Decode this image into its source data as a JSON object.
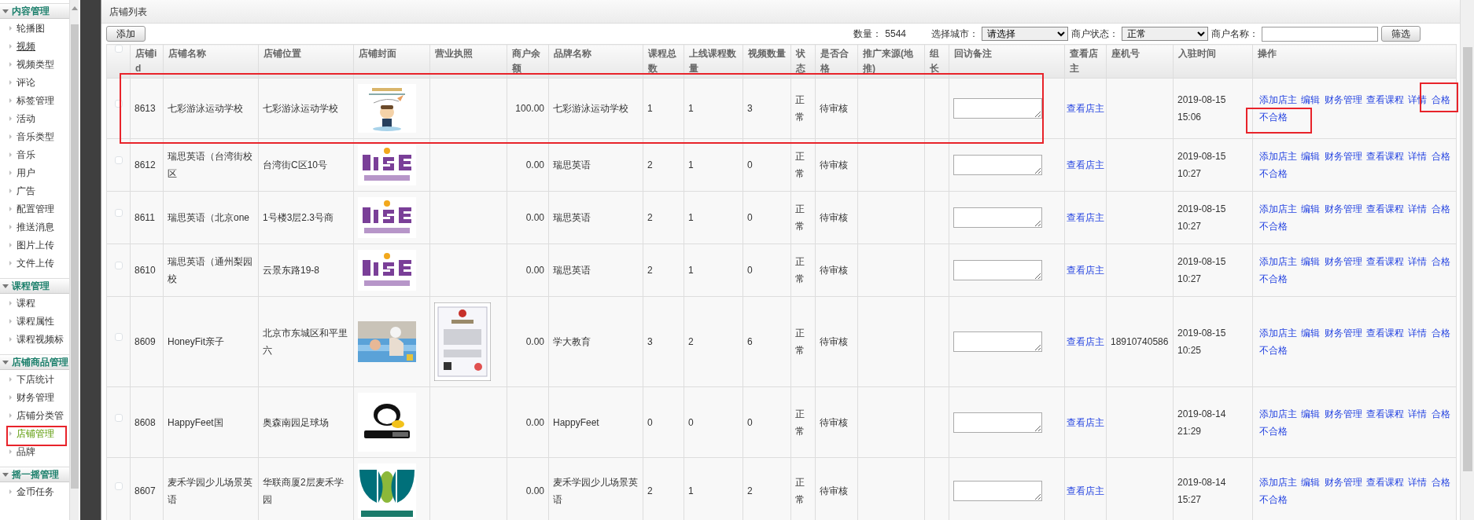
{
  "sidebar": {
    "groups": [
      {
        "title": "内容管理",
        "expanded": true,
        "items": [
          {
            "label": "轮播图",
            "selected": false,
            "hovered": false
          },
          {
            "label": "视频",
            "selected": false,
            "hovered": true
          },
          {
            "label": "视频类型",
            "selected": false,
            "hovered": false
          },
          {
            "label": "评论",
            "selected": false,
            "hovered": false
          },
          {
            "label": "标签管理",
            "selected": false,
            "hovered": false
          },
          {
            "label": "活动",
            "selected": false,
            "hovered": false
          },
          {
            "label": "音乐类型",
            "selected": false,
            "hovered": false
          },
          {
            "label": "音乐",
            "selected": false,
            "hovered": false
          },
          {
            "label": "用户",
            "selected": false,
            "hovered": false
          },
          {
            "label": "广告",
            "selected": false,
            "hovered": false
          },
          {
            "label": "配置管理",
            "selected": false,
            "hovered": false
          },
          {
            "label": "推送消息",
            "selected": false,
            "hovered": false
          },
          {
            "label": "图片上传",
            "selected": false,
            "hovered": false
          },
          {
            "label": "文件上传",
            "selected": false,
            "hovered": false
          }
        ]
      },
      {
        "title": "课程管理",
        "expanded": true,
        "items": [
          {
            "label": "课程",
            "selected": false,
            "hovered": false
          },
          {
            "label": "课程属性",
            "selected": false,
            "hovered": false
          },
          {
            "label": "课程视频标",
            "selected": false,
            "hovered": false
          }
        ]
      },
      {
        "title": "店铺商品管理",
        "expanded": true,
        "items": [
          {
            "label": "下店统计",
            "selected": false,
            "hovered": false
          },
          {
            "label": "财务管理",
            "selected": false,
            "hovered": false
          },
          {
            "label": "店铺分类管",
            "selected": false,
            "hovered": false
          },
          {
            "label": "店铺管理",
            "selected": true,
            "hovered": false
          },
          {
            "label": "品牌",
            "selected": false,
            "hovered": false
          }
        ]
      },
      {
        "title": "摇一摇管理",
        "expanded": true,
        "items": [
          {
            "label": "金币任务",
            "selected": false,
            "hovered": false
          }
        ]
      }
    ]
  },
  "panel": {
    "title": "店铺列表"
  },
  "toolbar": {
    "add_button": "添加",
    "count_label": "数量：",
    "count": "5544",
    "city_label": "选择城市：",
    "city_select": "请选择",
    "status_label": "商户状态：",
    "status_select": "正常",
    "name_label": "商户名称：",
    "search_button": "筛选"
  },
  "table": {
    "select_all": {
      "checked": false
    },
    "columns": [
      "店铺id",
      "店铺名称",
      "店铺位置",
      "店铺封面",
      "营业执照",
      "商户余额",
      "品牌名称",
      "课程总数",
      "上线课程数量",
      "视频数量",
      "状态",
      "是否合格",
      "推广来源(地推)",
      "组长",
      "回访备注",
      "查看店主",
      "座机号",
      "入驻时间",
      "操作"
    ],
    "rows": [
      {
        "checked": false,
        "id": "8613",
        "name": "七彩游泳运动学校",
        "location": "七彩游泳运动学校",
        "balance": "100.00",
        "brand": "七彩游泳运动学校",
        "course_total": "1",
        "online_courses": "1",
        "videos": "3",
        "status": "正常",
        "qualified": "待审核",
        "owner_link": "查看店主",
        "time": "2019-08-15 15:06",
        "actions": [
          "添加店主",
          "编辑",
          "财务管理",
          "查看课程",
          "详情",
          "合格",
          "不合格"
        ]
      },
      {
        "checked": false,
        "id": "8612",
        "name": "瑞思英语（台湾街校区",
        "location": "台湾街C区10号",
        "balance": "0.00",
        "brand": "瑞思英语",
        "course_total": "2",
        "online_courses": "1",
        "videos": "0",
        "status": "正常",
        "qualified": "待审核",
        "owner_link": "查看店主",
        "time": "2019-08-15 10:27",
        "actions": [
          "添加店主",
          "编辑",
          "财务管理",
          "查看课程",
          "详情",
          "合格",
          "不合格"
        ]
      },
      {
        "checked": false,
        "id": "8611",
        "name": "瑞思英语（北京one",
        "location": "1号楼3层2.3号商",
        "balance": "0.00",
        "brand": "瑞思英语",
        "course_total": "2",
        "online_courses": "1",
        "videos": "0",
        "status": "正常",
        "qualified": "待审核",
        "owner_link": "查看店主",
        "time": "2019-08-15 10:27",
        "actions": [
          "添加店主",
          "编辑",
          "财务管理",
          "查看课程",
          "详情",
          "合格",
          "不合格"
        ]
      },
      {
        "checked": false,
        "id": "8610",
        "name": "瑞思英语（通州梨园校",
        "location": "云景东路19-8",
        "balance": "0.00",
        "brand": "瑞思英语",
        "course_total": "2",
        "online_courses": "1",
        "videos": "0",
        "status": "正常",
        "qualified": "待审核",
        "owner_link": "查看店主",
        "time": "2019-08-15 10:27",
        "actions": [
          "添加店主",
          "编辑",
          "财务管理",
          "查看课程",
          "详情",
          "合格",
          "不合格"
        ]
      },
      {
        "checked": false,
        "id": "8609",
        "name": "HoneyFit亲子",
        "location": "北京市东城区和平里六",
        "balance": "0.00",
        "brand": "学大教育",
        "course_total": "3",
        "online_courses": "2",
        "videos": "6",
        "status": "正常",
        "qualified": "待审核",
        "owner_link": "查看店主",
        "phone": "18910740586",
        "time": "2019-08-15 10:25",
        "actions": [
          "添加店主",
          "编辑",
          "财务管理",
          "查看课程",
          "详情",
          "合格",
          "不合格"
        ]
      },
      {
        "checked": false,
        "id": "8608",
        "name": "HappyFeet国",
        "location": "奥森南园足球场",
        "balance": "0.00",
        "brand": "HappyFeet",
        "course_total": "0",
        "online_courses": "0",
        "videos": "0",
        "status": "正常",
        "qualified": "待审核",
        "owner_link": "查看店主",
        "time": "2019-08-14 21:29",
        "actions": [
          "添加店主",
          "编辑",
          "财务管理",
          "查看课程",
          "详情",
          "合格",
          "不合格"
        ]
      },
      {
        "checked": false,
        "id": "8607",
        "name": "麦禾学园少儿场景英语",
        "location": "华联商厦2层麦禾学园",
        "balance": "0.00",
        "brand": "麦禾学园少儿场景英语",
        "course_total": "2",
        "online_courses": "1",
        "videos": "2",
        "status": "正常",
        "qualified": "待审核",
        "owner_link": "查看店主",
        "time": "2019-08-14 15:27",
        "actions": [
          "添加店主",
          "编辑",
          "财务管理",
          "查看课程",
          "详情",
          "合格",
          "不合格"
        ]
      }
    ]
  }
}
